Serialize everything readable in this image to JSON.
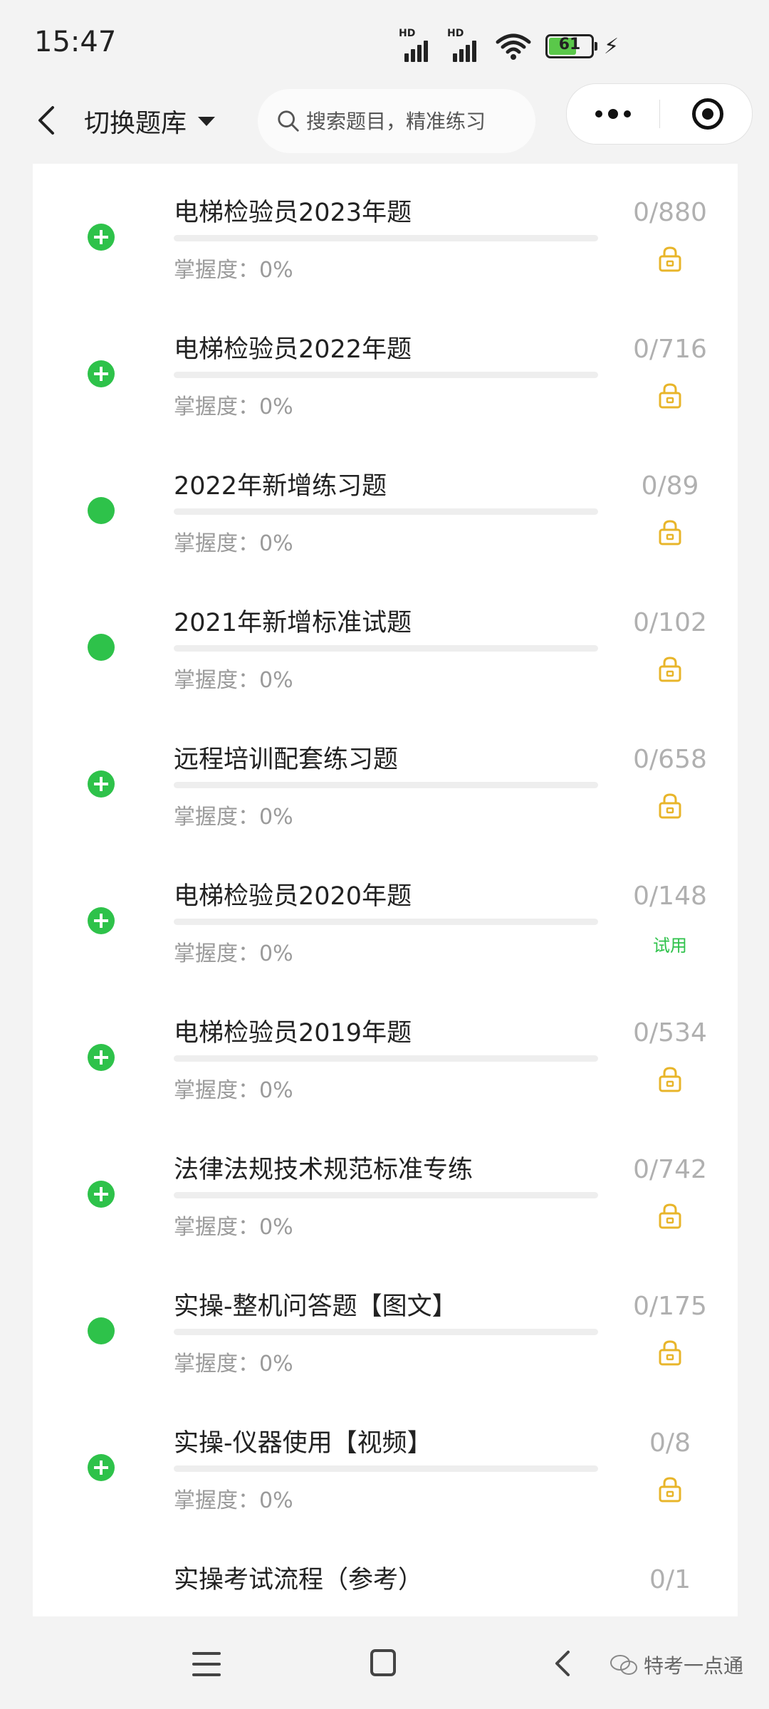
{
  "status_bar": {
    "time": "15:47",
    "battery_level": "61",
    "signal_label": "HD"
  },
  "nav": {
    "switch_label": "切换题库",
    "search_placeholder": "搜索题目，精准练习"
  },
  "items": [
    {
      "title": "电梯检验员2023年题",
      "mastery": "掌握度：0%",
      "count": "0/880",
      "icon": "plus-circle-icon",
      "badge": "lock-icon",
      "progress": 0
    },
    {
      "title": "电梯检验员2022年题",
      "mastery": "掌握度：0%",
      "count": "0/716",
      "icon": "plus-circle-icon",
      "badge": "lock-icon",
      "progress": 0
    },
    {
      "title": "2022年新增练习题",
      "mastery": "掌握度：0%",
      "count": "0/89",
      "icon": "dot-icon",
      "badge": "lock-icon",
      "progress": 0
    },
    {
      "title": "2021年新增标准试题",
      "mastery": "掌握度：0%",
      "count": "0/102",
      "icon": "dot-icon",
      "badge": "lock-icon",
      "progress": 0
    },
    {
      "title": "远程培训配套练习题",
      "mastery": "掌握度：0%",
      "count": "0/658",
      "icon": "plus-circle-icon",
      "badge": "lock-icon",
      "progress": 0
    },
    {
      "title": "电梯检验员2020年题",
      "mastery": "掌握度：0%",
      "count": "0/148",
      "icon": "plus-circle-icon",
      "badge": "trial",
      "badge_text": "试用",
      "progress": 0
    },
    {
      "title": "电梯检验员2019年题",
      "mastery": "掌握度：0%",
      "count": "0/534",
      "icon": "plus-circle-icon",
      "badge": "lock-icon",
      "progress": 0
    },
    {
      "title": "法律法规技术规范标准专练",
      "mastery": "掌握度：0%",
      "count": "0/742",
      "icon": "plus-circle-icon",
      "badge": "lock-icon",
      "progress": 0
    },
    {
      "title": "实操-整机问答题【图文】",
      "mastery": "掌握度：0%",
      "count": "0/175",
      "icon": "dot-icon",
      "badge": "lock-icon",
      "progress": 0
    },
    {
      "title": "实操-仪器使用【视频】",
      "mastery": "掌握度：0%",
      "count": "0/8",
      "icon": "plus-circle-icon",
      "badge": "lock-icon",
      "progress": 0
    },
    {
      "title": "实操考试流程（参考）",
      "mastery": "",
      "count": "0/1",
      "icon": "none",
      "badge": "none",
      "progress": 0
    }
  ],
  "watermark": "特考一点通",
  "colors": {
    "accent_green": "#2ec24a",
    "lock_yellow": "#e8b52a",
    "count_gray": "#b0b0b0"
  }
}
